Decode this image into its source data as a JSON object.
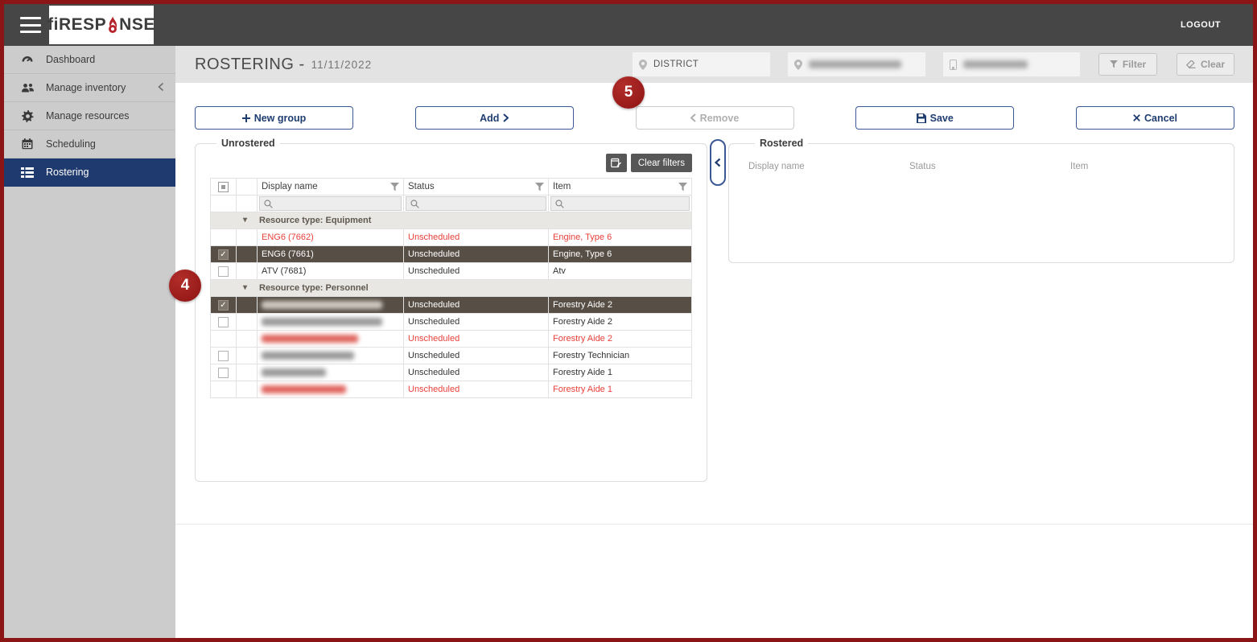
{
  "topbar": {
    "logo_pre": "fiRESP",
    "logo_post": "NSE",
    "logout_label": "LOGOUT"
  },
  "sidebar": {
    "items": [
      {
        "label": "Dashboard",
        "icon": "gauge-icon"
      },
      {
        "label": "Manage inventory",
        "icon": "users-icon",
        "has_submenu": true
      },
      {
        "label": "Manage resources",
        "icon": "gear-icon"
      },
      {
        "label": "Scheduling",
        "icon": "calendar-icon"
      },
      {
        "label": "Rostering",
        "icon": "list-icon",
        "selected": true
      }
    ]
  },
  "header": {
    "title": "ROSTERING -",
    "date": "11/11/2022",
    "district_value": "DISTRICT",
    "blurred_field_count": 2,
    "filter_label": "Filter",
    "clear_label": "Clear"
  },
  "actions": {
    "new_group_label": "New group",
    "add_label": "Add",
    "remove_label": "Remove",
    "save_label": "Save",
    "cancel_label": "Cancel"
  },
  "unrostered": {
    "legend": "Unrostered",
    "clear_filters_label": "Clear filters",
    "columns": [
      "Display name",
      "Status",
      "Item"
    ],
    "rows": [
      {
        "type": "group",
        "label": "Resource type: Equipment"
      },
      {
        "type": "item",
        "name": "ENG6 (7662)",
        "status": "Unscheduled",
        "item": "Engine, Type 6",
        "style": "red",
        "checkbox": "none"
      },
      {
        "type": "item",
        "name": "ENG6 (7661)",
        "status": "Unscheduled",
        "item": "Engine, Type 6",
        "style": "selected",
        "checkbox": "checked"
      },
      {
        "type": "item",
        "name": "ATV (7681)",
        "status": "Unscheduled",
        "item": "Atv",
        "style": "normal",
        "checkbox": "unchecked"
      },
      {
        "type": "group",
        "label": "Resource type: Personnel"
      },
      {
        "type": "item",
        "name": "",
        "blurred": true,
        "blur_width": 150,
        "status": "Unscheduled",
        "item": "Forestry Aide 2",
        "style": "selected",
        "checkbox": "checked"
      },
      {
        "type": "item",
        "name": "",
        "blurred": true,
        "blur_width": 150,
        "status": "Unscheduled",
        "item": "Forestry Aide 2",
        "style": "normal",
        "checkbox": "unchecked"
      },
      {
        "type": "item",
        "name": "",
        "blurred": true,
        "blur_width": 120,
        "status": "Unscheduled",
        "item": "Forestry Aide 2",
        "style": "red",
        "checkbox": "none"
      },
      {
        "type": "item",
        "name": "",
        "blurred": true,
        "blur_width": 115,
        "status": "Unscheduled",
        "item": "Forestry Technician",
        "style": "normal",
        "checkbox": "unchecked"
      },
      {
        "type": "item",
        "name": "",
        "blurred": true,
        "blur_width": 80,
        "status": "Unscheduled",
        "item": "Forestry Aide 1",
        "style": "normal",
        "checkbox": "unchecked"
      },
      {
        "type": "item",
        "name": "",
        "blurred": true,
        "blur_width": 105,
        "status": "Unscheduled",
        "item": "Forestry Aide 1",
        "style": "red",
        "checkbox": "none"
      }
    ]
  },
  "rostered": {
    "legend": "Rostered",
    "columns": [
      "Display name",
      "Status",
      "Item"
    ]
  },
  "annotations": {
    "badge4": "4",
    "badge5": "5"
  },
  "colors": {
    "frame_border": "#8b1414",
    "topbar_bg": "#464646",
    "sidebar_bg": "#cccccc",
    "sidebar_selected_bg": "#1e3a6e",
    "accent_navy": "#1f3d70",
    "header_band_bg": "#e3e3e3",
    "selected_row_bg": "#574f46",
    "alert_red_text": "#e8403a",
    "badge_red": "#9e1b1b",
    "dark_button_bg": "#575757"
  }
}
